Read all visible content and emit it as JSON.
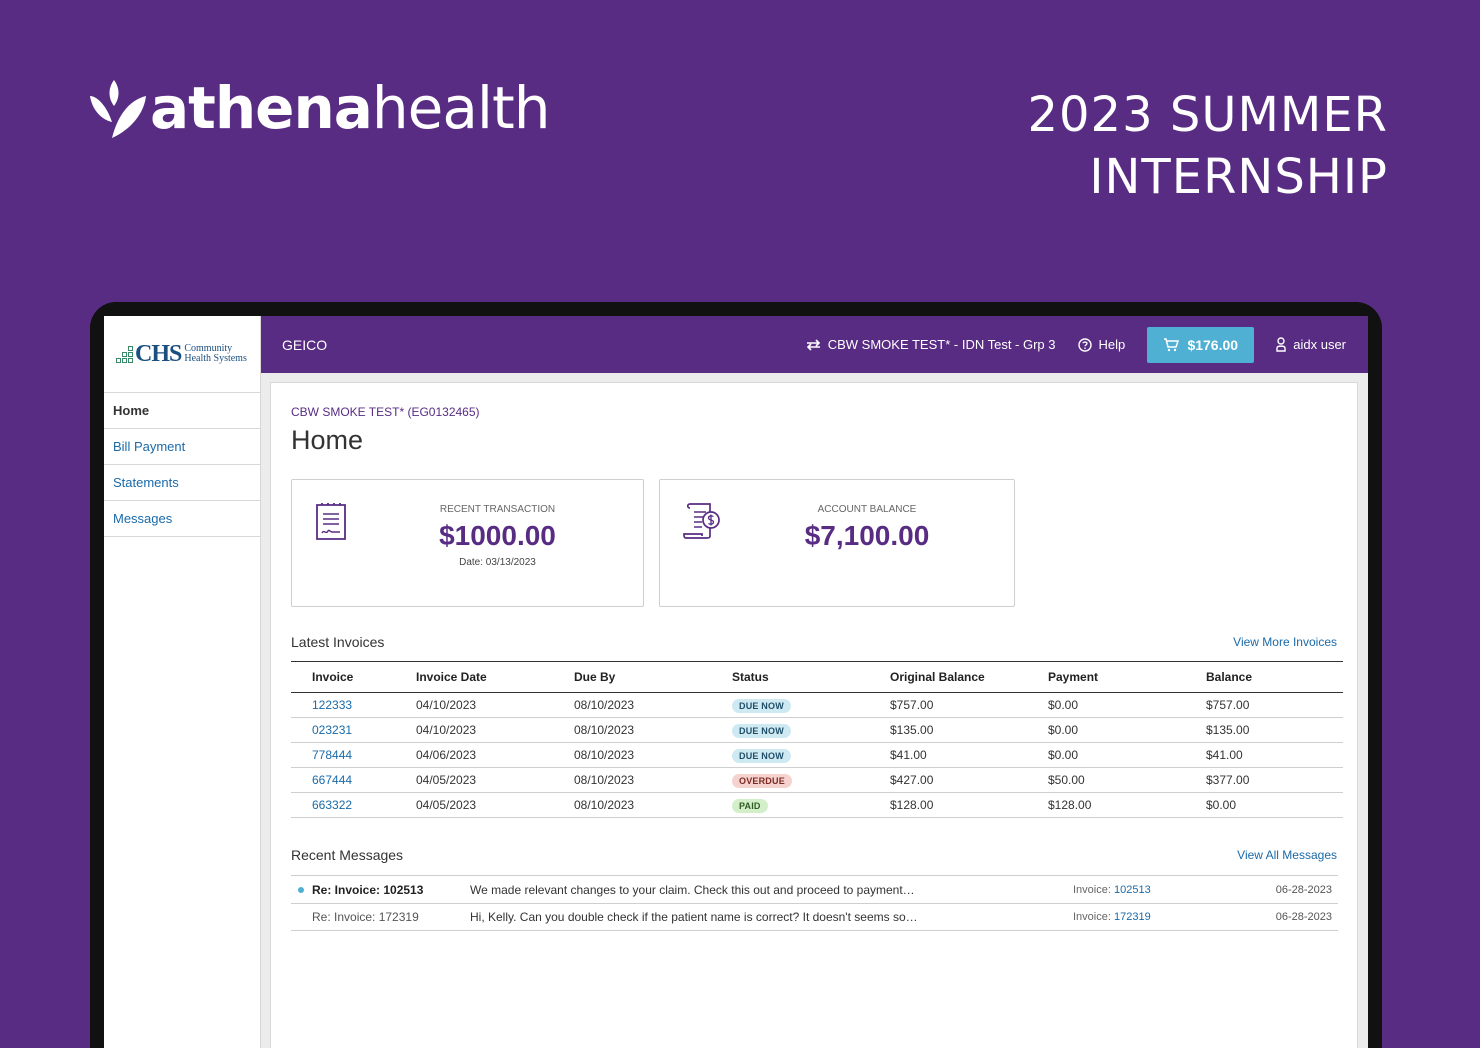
{
  "hero": {
    "brand_bold": "athena",
    "brand_light": "health",
    "headline_line1": "2023 SUMMER",
    "headline_line2": "INTERNSHIP"
  },
  "sidebar": {
    "logo_big": "CHS",
    "logo_small_1": "Community",
    "logo_small_2": "Health Systems",
    "items": [
      {
        "label": "Home",
        "active": true
      },
      {
        "label": "Bill Payment"
      },
      {
        "label": "Statements"
      },
      {
        "label": "Messages"
      }
    ]
  },
  "topbar": {
    "org": "GEICO",
    "switch_label": "CBW SMOKE TEST* - IDN Test - Grp 3",
    "help_label": "Help",
    "cart_amount": "$176.00",
    "user_label": "aidx user",
    "accent": "#582c83",
    "cart_color": "#4fb0d4"
  },
  "main": {
    "account_label": "CBW SMOKE TEST* (EG0132465)",
    "title": "Home",
    "cards": [
      {
        "label": "RECENT TRANSACTION",
        "amount": "$1000.00",
        "sub": "Date: 03/13/2023",
        "icon": "receipt-icon"
      },
      {
        "label": "ACCOUNT BALANCE",
        "amount": "$7,100.00",
        "icon": "invoice-dollar-icon"
      }
    ],
    "invoices_title": "Latest Invoices",
    "invoices_link": "View More Invoices",
    "invoice_headers": [
      "Invoice",
      "Invoice Date",
      "Due By",
      "Status",
      "Original Balance",
      "Payment",
      "Balance"
    ],
    "invoices": [
      {
        "id": "122333",
        "date": "04/10/2023",
        "due": "08/10/2023",
        "status": "DUE NOW",
        "orig": "$757.00",
        "payment": "$0.00",
        "balance": "$757.00"
      },
      {
        "id": "023231",
        "date": "04/10/2023",
        "due": "08/10/2023",
        "status": "DUE NOW",
        "orig": "$135.00",
        "payment": "$0.00",
        "balance": "$135.00"
      },
      {
        "id": "778444",
        "date": "04/06/2023",
        "due": "08/10/2023",
        "status": "DUE NOW",
        "orig": "$41.00",
        "payment": "$0.00",
        "balance": "$41.00"
      },
      {
        "id": "667444",
        "date": "04/05/2023",
        "due": "08/10/2023",
        "status": "OVERDUE",
        "orig": "$427.00",
        "payment": "$50.00",
        "balance": "$377.00"
      },
      {
        "id": "663322",
        "date": "04/05/2023",
        "due": "08/10/2023",
        "status": "PAID",
        "orig": "$128.00",
        "payment": "$128.00",
        "balance": "$0.00"
      }
    ],
    "messages_title": "Recent Messages",
    "messages_link": "View All Messages",
    "messages": [
      {
        "subject": "Re: Invoice: 102513",
        "body": "We made relevant changes to your claim. Check this out and proceed to payment…",
        "ref_label": "Invoice:",
        "ref": "102513",
        "date": "06-28-2023",
        "unread": true
      },
      {
        "subject": "Re: Invoice: 172319",
        "body": "Hi, Kelly. Can you double check if the patient name is correct? It doesn't seems so…",
        "ref_label": "Invoice:",
        "ref": "172319",
        "date": "06-28-2023",
        "unread": false
      }
    ]
  }
}
